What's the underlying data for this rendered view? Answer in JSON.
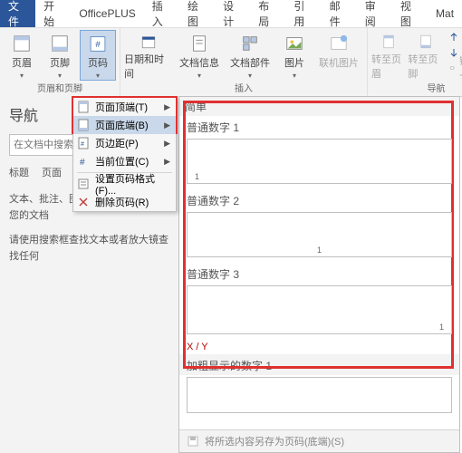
{
  "tabs": {
    "file": "文件",
    "home": "开始",
    "officeplus": "OfficePLUS",
    "insert": "插入",
    "draw": "绘图",
    "design": "设计",
    "layout": "布局",
    "references": "引用",
    "mail": "邮件",
    "review": "审阅",
    "view": "视图",
    "mat": "Mat"
  },
  "ribbon": {
    "header_footer_group": "页眉和页脚",
    "header": "页眉",
    "footer": "页脚",
    "pagenum": "页码",
    "datetime": "日期和时间",
    "docinfo": "文档信息",
    "docparts": "文档部件",
    "picture": "图片",
    "online_pic": "联机图片",
    "insert_group": "插入",
    "goto_header": "转至页眉",
    "goto_footer": "转至页脚",
    "prev": "上一条",
    "next": "下一条",
    "link_prev": "链接到前一节",
    "nav_group": "导航"
  },
  "dropdown": {
    "top": "页面顶端(T)",
    "bottom": "页面底端(B)",
    "margins": "页边距(P)",
    "current": "当前位置(C)",
    "format": "设置页码格式(F)...",
    "remove": "删除页码(R)"
  },
  "navpane": {
    "title": "导航",
    "search_placeholder": "在文档中搜索",
    "tab_headings": "标题",
    "tab_pages": "页面",
    "line1": "文本、批注、图片...Word 可以查找您的文档",
    "line2": "请使用搜索框查找文本或者放大镜查找任何"
  },
  "gallery": {
    "section_simple": "简单",
    "item1": "普通数字 1",
    "item2": "普通数字 2",
    "item3": "普通数字 3",
    "xy": "X / Y",
    "section_bold": "加粗显示的数字 1",
    "footer": "将所选内容另存为页码(底端)(S)"
  }
}
